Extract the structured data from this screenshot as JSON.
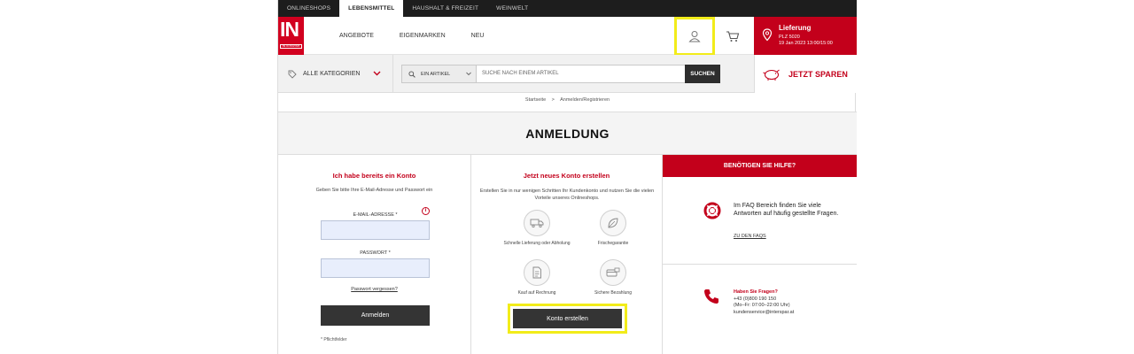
{
  "top_tabs": [
    "ONLINESHOPS",
    "LEBENSMITTEL",
    "HAUSHALT & FREIZEIT",
    "WEINWELT"
  ],
  "logo": {
    "text": "IN",
    "subtext": "INTERSPAR"
  },
  "nav": [
    "ANGEBOTE",
    "EIGENMARKEN",
    "NEU"
  ],
  "delivery": {
    "title": "Lieferung",
    "plz": "PLZ 5020",
    "date": "19 Jan 2023  13:00/15:00"
  },
  "categories": {
    "label": "ALLE KATEGORIEN"
  },
  "search": {
    "scope": "EIN ARTIKEL",
    "placeholder": "SUCHE NACH EINEM ARTIKEL",
    "button": "SUCHEN"
  },
  "promo": {
    "label": "JETZT SPAREN"
  },
  "breadcrumb": {
    "home": "Startseite",
    "separator": ">",
    "current": "Anmelden/Registrieren"
  },
  "page_title": "ANMELDUNG",
  "login": {
    "title": "Ich habe bereits ein Konto",
    "description": "Geben Sie bitte Ihre E-Mail-Adresse und Passwort ein",
    "info": "i",
    "email_label": "E-MAIL-ADRESSE *",
    "password_label": "PASSWORT *",
    "forgot": "Passwort vergessen?",
    "button": "Anmelden",
    "required_note": "* Pflichtfelder"
  },
  "register": {
    "title": "Jetzt neues Konto erstellen",
    "description": "Erstellen Sie in nur wenigen Schritten Ihr Kundenkonto und nutzen Sie die vielen Vorteile unseres Onlineshops.",
    "benefits": [
      {
        "label": "Schnelle Lieferung oder Abholung",
        "icon": "delivery-truck-icon"
      },
      {
        "label": "Frischegarantie",
        "icon": "leaf-icon"
      },
      {
        "label": "Kauf auf Rechnung",
        "icon": "invoice-icon"
      },
      {
        "label": "Sichere Bezahlung",
        "icon": "secure-payment-icon"
      }
    ],
    "button": "Konto erstellen"
  },
  "help": {
    "header": "BENÖTIGEN SIE HILFE?",
    "faq_text": "Im FAQ Bereich finden Sie viele Antworten auf häufig gestellte Fragen.",
    "faq_link": "ZU DEN FAQS",
    "contact_title": "Haben Sie Fragen?",
    "phone": "+43 (0)800 190 150",
    "hours": "(Mo–Fr: 07:00–22:00 Uhr)",
    "email": "kundenservice@interspar.at"
  },
  "colors": {
    "brand_red": "#c3001b",
    "dark": "#343434",
    "highlight": "#f2ec1a"
  }
}
